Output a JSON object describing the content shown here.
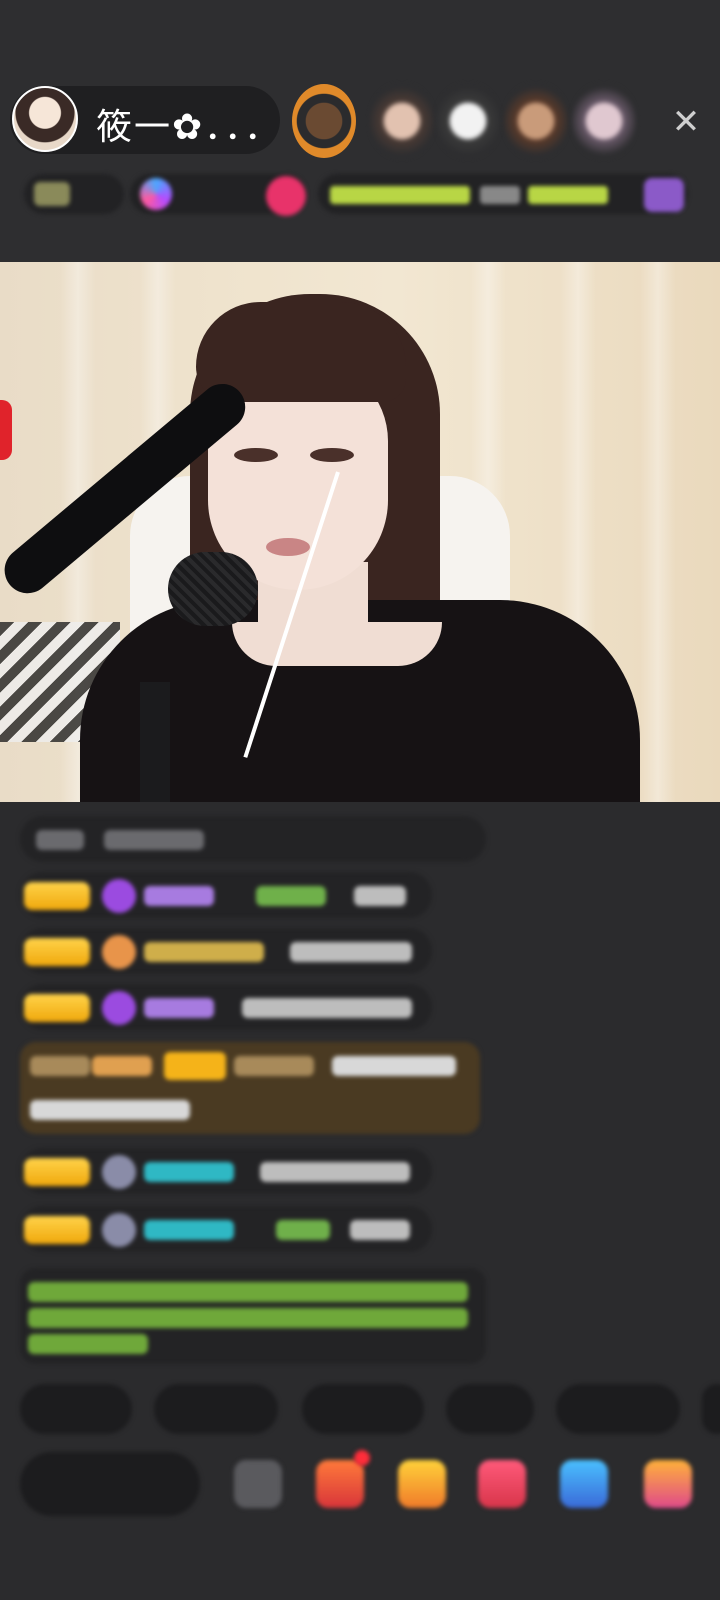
{
  "header": {
    "host_name": "筱一✿．．．"
  },
  "icons": {
    "close": "close-icon",
    "gift": "gift-icon"
  },
  "colors": {
    "badge": "#f5b319",
    "accent_green": "#b8d645",
    "accent_cyan": "#2fb8c4",
    "accent_purple": "#9b4be0",
    "chat_bubble": "#232325"
  }
}
